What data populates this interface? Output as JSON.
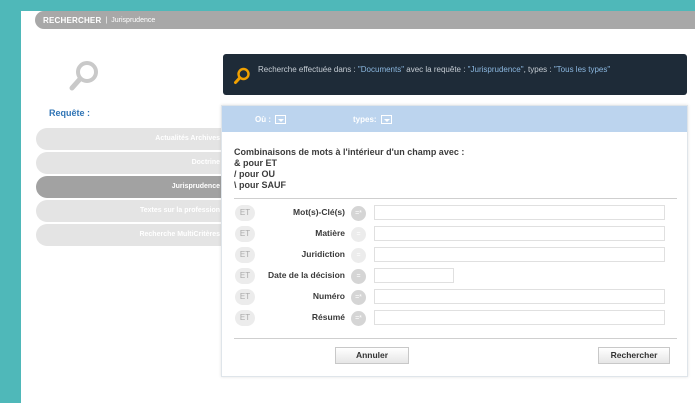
{
  "topbar": {
    "brand": "RECHERCHER",
    "separator": "|",
    "crumb": "Jurisprudence"
  },
  "requete_label": "Requête :",
  "sidebar": {
    "items": [
      {
        "label": "Actualités Archives",
        "active": false
      },
      {
        "label": "Doctrine",
        "active": false
      },
      {
        "label": "Jurisprudence",
        "active": true
      },
      {
        "label": "Textes sur la profession",
        "active": false
      },
      {
        "label": "Recherche MultiCritères",
        "active": false
      }
    ]
  },
  "banner": {
    "p1": "Recherche effectuée dans : ",
    "docs": "\"Documents\"",
    "p2": " avec la requête : ",
    "query": "\"Jurisprudence\"",
    "p3": ", types : ",
    "types": "\"Tous les types\""
  },
  "panel": {
    "ou_label": "Où :",
    "types_label": "types:",
    "help": [
      "Combinaisons de mots à l'intérieur d'un champ avec :",
      "& pour ET",
      "/ pour OU",
      "\\ pour SAUF"
    ],
    "fields": [
      {
        "et": "ET",
        "label": "Mot(s)-Clé(s)",
        "op": "=*",
        "value": ""
      },
      {
        "et": "ET",
        "label": "Matière",
        "op": "=",
        "value": ""
      },
      {
        "et": "ET",
        "label": "Juridiction",
        "op": "=",
        "value": ""
      },
      {
        "et": "ET",
        "label": "Date de la décision",
        "op": "=",
        "value": ""
      },
      {
        "et": "ET",
        "label": "Numéro",
        "op": "=*",
        "value": ""
      },
      {
        "et": "ET",
        "label": "Résumé",
        "op": "=*",
        "value": ""
      }
    ],
    "cancel_label": "Annuler",
    "search_label": "Rechercher"
  },
  "colors": {
    "background": "#4fb8b9",
    "banner_bg": "#1e2b38",
    "accent_orange": "#f0a000",
    "panel_head": "#bcd4ee",
    "link_blue": "#2f74b5"
  },
  "icons": {
    "big_search": "search-icon",
    "banner_search": "search-icon",
    "dropdown": "dropdown-icon"
  }
}
